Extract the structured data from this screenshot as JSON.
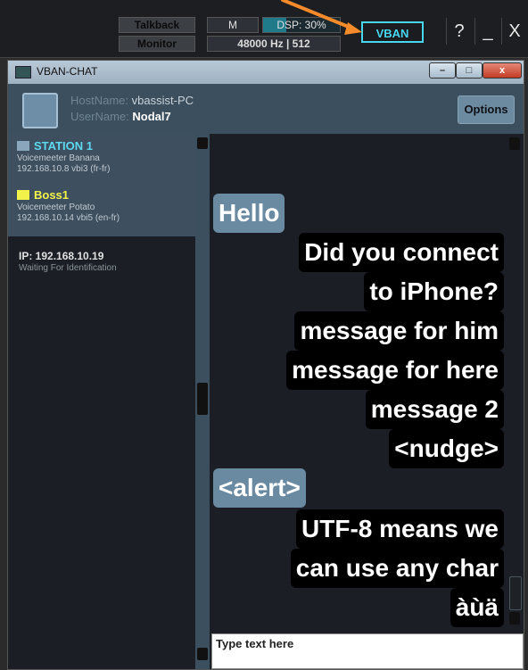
{
  "topbar": {
    "talkback_label": "Talkback",
    "monitor_label": "Monitor",
    "m_label": "M",
    "dsp_label": "DSP: 30%",
    "dsp_load_percent": 30,
    "freq_label": "48000 Hz | 512",
    "vban_label": "VBAN",
    "help_label": "?",
    "minimize_label": "_",
    "close_label": "X",
    "accent_color": "#48d6f0",
    "arrow_color": "#f58a2a"
  },
  "window": {
    "title": "VBAN-CHAT",
    "minimize_label": "–",
    "maximize_label": "□",
    "close_label": "x"
  },
  "header": {
    "hostname_key": "HostName:",
    "hostname_value": "vbassist-PC",
    "username_key": "UserName:",
    "username_value": "Nodal7",
    "options_label": "Options"
  },
  "stations": [
    {
      "name": "STATION 1",
      "app": "Voicemeeter Banana",
      "address": "192.168.10.8 vbi3 (fr-fr)",
      "color": "#8aa6bc"
    },
    {
      "name": "Boss1",
      "app": "Voicemeeter Potato",
      "address": "192.168.10.14 vbi5 (en-fr)",
      "color": "#f2f24a"
    }
  ],
  "pending": {
    "ip_label": "IP: 192.168.10.19",
    "status": "Waiting For Identification"
  },
  "messages": [
    {
      "text": "Hello",
      "direction": "incoming"
    },
    {
      "text": "Did you connect",
      "direction": "outgoing"
    },
    {
      "text": "to iPhone?",
      "direction": "outgoing"
    },
    {
      "text": "message for him",
      "direction": "outgoing"
    },
    {
      "text": "message for here",
      "direction": "outgoing"
    },
    {
      "text": "message 2",
      "direction": "outgoing"
    },
    {
      "text": "<nudge>",
      "direction": "outgoing"
    },
    {
      "text": "<alert>",
      "direction": "incoming"
    },
    {
      "text": "UTF-8 means we",
      "direction": "outgoing"
    },
    {
      "text": "can use any char",
      "direction": "outgoing"
    },
    {
      "text": "àùä",
      "direction": "outgoing"
    }
  ],
  "input": {
    "placeholder": "Type text here",
    "value": ""
  }
}
